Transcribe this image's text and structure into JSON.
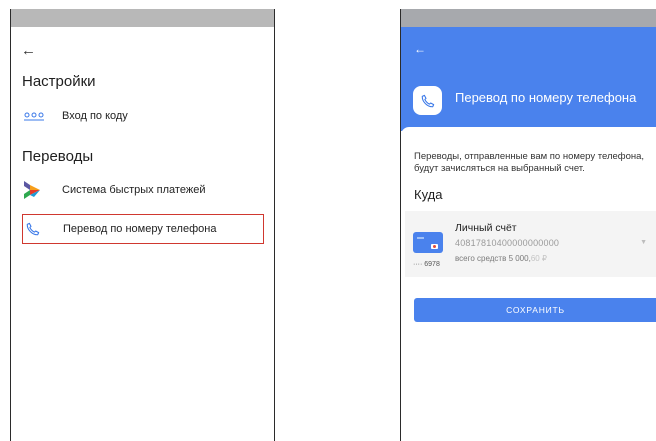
{
  "left_screen": {
    "back_icon": "arrow-left-icon",
    "settings_title": "Настройки",
    "settings_items": [
      {
        "label": "Вход по коду",
        "icon": "dots-code-icon"
      }
    ],
    "transfers_title": "Переводы",
    "transfers_items": [
      {
        "label": "Система быстрых платежей",
        "icon": "sbp-logo-icon"
      },
      {
        "label": "Перевод по номеру телефона",
        "icon": "phone-icon",
        "highlighted": true
      }
    ],
    "highlight_color": "#d0382f"
  },
  "right_screen": {
    "back_icon": "arrow-left-icon",
    "title": "Перевод по номеру телефона",
    "header_color": "#4a82ed",
    "description": "Переводы, отправленные вам по номеру телефона, будут зачисляться на выбранный счет.",
    "destination_label": "Куда",
    "account": {
      "name": "Личный счёт",
      "number": "40817810400000000000",
      "card_mask": "···· 6978",
      "balance_prefix": "всего средств",
      "balance_main": "5 000,",
      "balance_cents": "60 ₽"
    },
    "save_button": "СОХРАНИТЬ"
  }
}
